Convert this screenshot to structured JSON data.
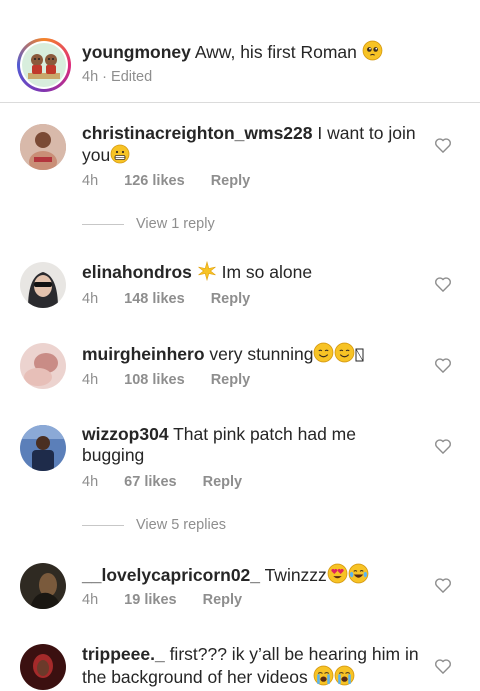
{
  "caption": {
    "username": "youngmoney",
    "text": "Aww, his first Roman",
    "time": "4h",
    "separator": "·",
    "edited": "Edited"
  },
  "comments": [
    {
      "username": "christinacreighton_wms228",
      "text": "I want to join you",
      "time": "4h",
      "likes": "126 likes",
      "reply": "Reply",
      "avatar_color": "#c7a395",
      "view_replies": "View 1 reply"
    },
    {
      "username": "elinahondros",
      "text": "Im so alone",
      "time": "4h",
      "likes": "148 likes",
      "reply": "Reply",
      "avatar_color": "#3a3f46"
    },
    {
      "username": "muirgheinhero",
      "text": "very stunning",
      "time": "4h",
      "likes": "108 likes",
      "reply": "Reply",
      "avatar_color": "#e2b9b5"
    },
    {
      "username": "wizzop304",
      "text": "That pink patch had me bugging",
      "time": "4h",
      "likes": "67 likes",
      "reply": "Reply",
      "avatar_color": "#4d6fa8",
      "view_replies": "View 5 replies"
    },
    {
      "username": "__lovelycapricorn02_",
      "text": "Twinzzz",
      "time": "4h",
      "likes": "19 likes",
      "reply": "Reply",
      "avatar_color": "#3e3528"
    },
    {
      "username": "trippeee._",
      "text": "first??? ik y’all be hearing him in the background of her videos",
      "avatar_color": "#5a1a1a"
    }
  ],
  "icons": {
    "like": "heart-outline-icon",
    "pleading": "pleading-face-emoji",
    "grimace": "grimacing-face-emoji",
    "sparkle": "sparkle-emoji",
    "smile": "smiling-face-emoji",
    "heart_eyes": "heart-eyes-emoji",
    "laugh": "tears-of-joy-emoji",
    "crying": "loudly-crying-emoji"
  },
  "colors": {
    "text": "#262626",
    "muted": "#8e8e8e",
    "divider": "#dbdbdb",
    "emoji_yellow": "#f7c325"
  }
}
